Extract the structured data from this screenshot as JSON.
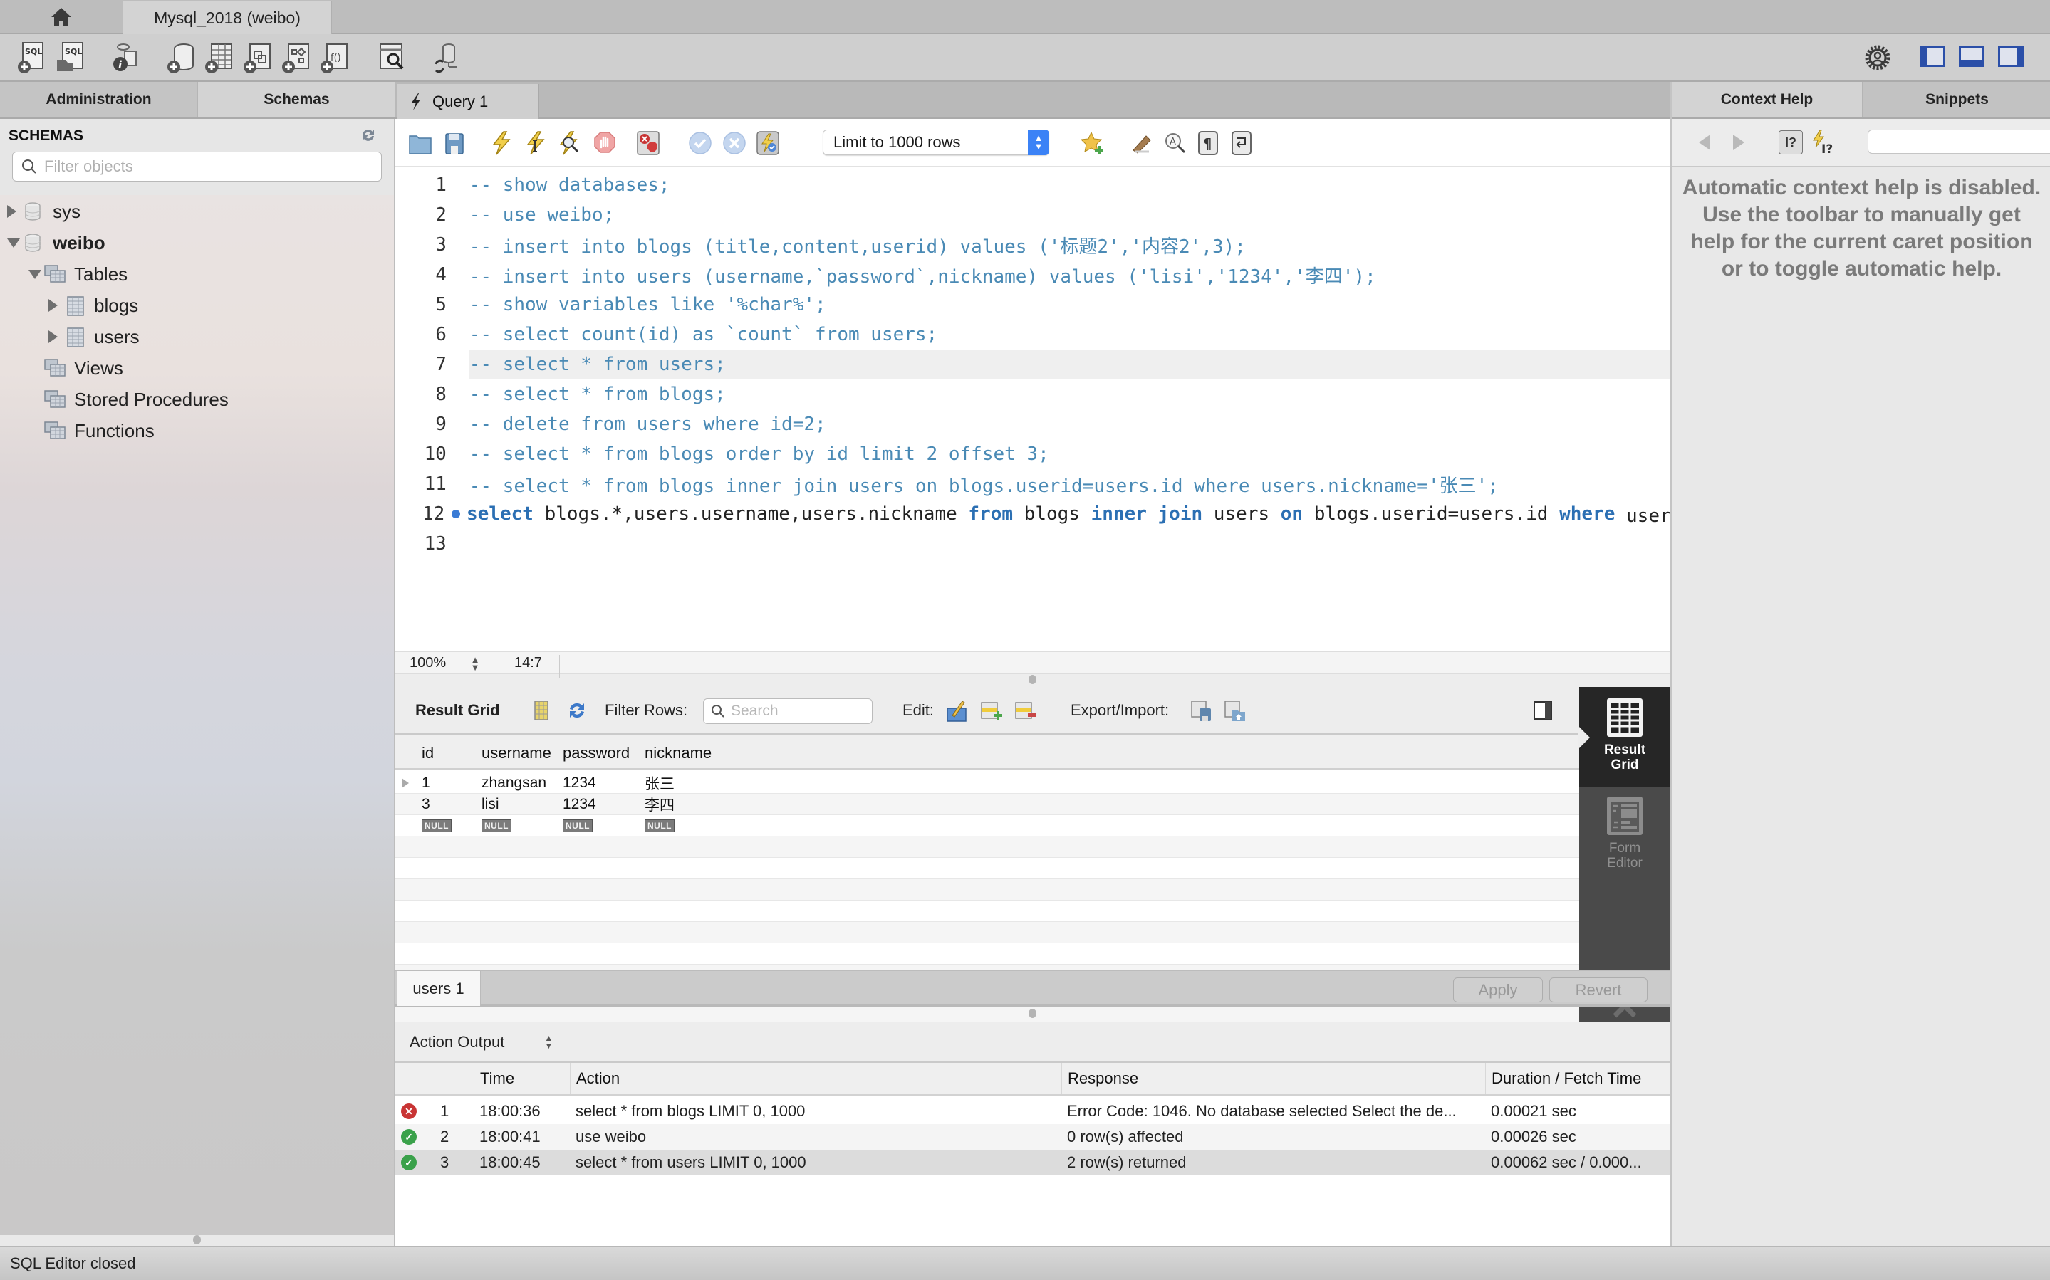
{
  "window": {
    "connection_tab": "Mysql_2018 (weibo)"
  },
  "toolbar": {
    "icons": [
      "new-sql-tab-icon",
      "open-sql-file-icon",
      "schema-inspector-icon",
      "create-schema-icon",
      "create-table-icon",
      "create-view-icon",
      "create-procedure-icon",
      "create-function-icon",
      "search-table-data-icon",
      "reconnect-icon"
    ],
    "right_icons": [
      "preferences-gear-icon",
      "toggle-sidebar-icon",
      "toggle-output-icon",
      "toggle-right-panel-icon"
    ]
  },
  "sidebar": {
    "tabs": [
      {
        "label": "Administration",
        "active": false
      },
      {
        "label": "Schemas",
        "active": true
      }
    ],
    "title": "SCHEMAS",
    "filter_placeholder": "Filter objects",
    "tree": [
      {
        "label": "sys",
        "level": 0,
        "expanded": false,
        "bold": false,
        "icon": "database"
      },
      {
        "label": "weibo",
        "level": 0,
        "expanded": true,
        "bold": true,
        "icon": "database"
      },
      {
        "label": "Tables",
        "level": 1,
        "expanded": true,
        "bold": false,
        "icon": "folder"
      },
      {
        "label": "blogs",
        "level": 2,
        "expanded": false,
        "bold": false,
        "icon": "table"
      },
      {
        "label": "users",
        "level": 2,
        "expanded": false,
        "bold": false,
        "icon": "table"
      },
      {
        "label": "Views",
        "level": 1,
        "expanded": null,
        "bold": false,
        "icon": "folder"
      },
      {
        "label": "Stored Procedures",
        "level": 1,
        "expanded": null,
        "bold": false,
        "icon": "folder"
      },
      {
        "label": "Functions",
        "level": 1,
        "expanded": null,
        "bold": false,
        "icon": "folder"
      }
    ]
  },
  "editor": {
    "tab_label": "Query 1",
    "limit_select": "Limit to 1000 rows",
    "lines": [
      {
        "n": "1",
        "tokens": [
          [
            "cm",
            "-- show databases;"
          ]
        ]
      },
      {
        "n": "2",
        "tokens": [
          [
            "cm",
            "-- use weibo;"
          ]
        ]
      },
      {
        "n": "3",
        "tokens": [
          [
            "cm",
            "-- insert into blogs (title,content,userid) values ('标题2','内容2',3);"
          ]
        ]
      },
      {
        "n": "4",
        "tokens": [
          [
            "cm",
            "-- insert into users (username,`password`,nickname) values ('lisi','1234','李四');"
          ]
        ]
      },
      {
        "n": "5",
        "tokens": [
          [
            "cm",
            "-- show variables like '%char%';"
          ]
        ]
      },
      {
        "n": "6",
        "tokens": [
          [
            "cm",
            "-- select count(id) as `count` from users;"
          ]
        ]
      },
      {
        "n": "7",
        "tokens": [
          [
            "cm",
            "-- select * from users;"
          ]
        ],
        "current": true
      },
      {
        "n": "8",
        "tokens": [
          [
            "cm",
            "-- select * from blogs;"
          ]
        ]
      },
      {
        "n": "9",
        "tokens": [
          [
            "cm",
            "-- delete from users where id=2;"
          ]
        ]
      },
      {
        "n": "10",
        "tokens": [
          [
            "cm",
            "-- select * from blogs order by id limit 2 offset 3;"
          ]
        ]
      },
      {
        "n": "11",
        "tokens": [
          [
            "cm",
            "-- select * from blogs inner join users on blogs.userid=users.id where users.nickname='张三';"
          ]
        ]
      },
      {
        "n": "12",
        "marker": true,
        "tokens": [
          [
            "kw",
            "select"
          ],
          [
            "tx",
            " blogs.*,users.username,users.nickname "
          ],
          [
            "kw",
            "from"
          ],
          [
            "tx",
            " blogs "
          ],
          [
            "kw",
            "inner join"
          ],
          [
            "tx",
            " users "
          ],
          [
            "kw",
            "on"
          ],
          [
            "tx",
            " blogs.userid=users.id "
          ],
          [
            "kw",
            "where"
          ],
          [
            "tx",
            " users.nickname='张三';"
          ]
        ]
      },
      {
        "n": "13",
        "tokens": []
      }
    ],
    "zoom": "100%",
    "cursor_position": "14:7"
  },
  "result": {
    "title": "Result Grid",
    "filter_label": "Filter Rows:",
    "search_placeholder": "Search",
    "edit_label": "Edit:",
    "export_label": "Export/Import:",
    "columns": [
      "id",
      "username",
      "password",
      "nickname"
    ],
    "rows": [
      [
        "1",
        "zhangsan",
        "1234",
        "张三"
      ],
      [
        "3",
        "lisi",
        "1234",
        "李四"
      ]
    ],
    "null_label": "NULL",
    "view_result_grid": "Result Grid",
    "view_form_editor": "Form Editor",
    "result_tab": "users 1",
    "apply_label": "Apply",
    "revert_label": "Revert"
  },
  "action_output": {
    "title": "Action Output",
    "columns": [
      "",
      "",
      "Time",
      "Action",
      "Response",
      "Duration / Fetch Time"
    ],
    "rows": [
      {
        "status": "error",
        "n": "1",
        "time": "18:00:36",
        "action": "select * from blogs LIMIT 0, 1000",
        "response": "Error Code: 1046. No database selected Select the de...",
        "duration": "0.00021 sec"
      },
      {
        "status": "ok",
        "n": "2",
        "time": "18:00:41",
        "action": "use weibo",
        "response": "0 row(s) affected",
        "duration": "0.00026 sec"
      },
      {
        "status": "ok",
        "n": "3",
        "time": "18:00:45",
        "action": "select * from users LIMIT 0, 1000",
        "response": "2 row(s) returned",
        "duration": "0.00062 sec / 0.000...",
        "selected": true
      }
    ]
  },
  "right_panel": {
    "tabs": [
      {
        "label": "Context Help",
        "active": true
      },
      {
        "label": "Snippets",
        "active": false
      }
    ],
    "help_text": "Automatic context help is disabled. Use the toolbar to manually get help for the current caret position or to toggle automatic help."
  },
  "statusbar": {
    "text": "SQL Editor closed"
  },
  "colors": {
    "accent_blue": "#3b82f6",
    "comment": "#4a8ab5",
    "keyword": "#2b6fb3",
    "error": "#c83434",
    "success": "#3aa14a"
  }
}
